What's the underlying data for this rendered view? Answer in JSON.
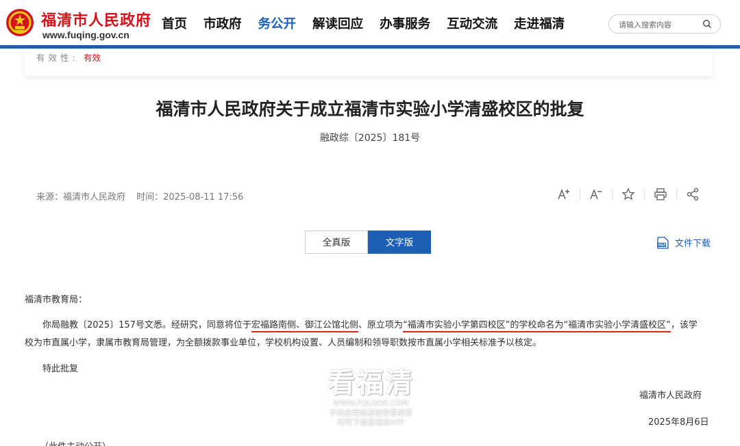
{
  "header": {
    "site_title": "福清市人民政府",
    "site_url": "www.fuqing.gov.cn",
    "nav": [
      "首页",
      "市政府",
      "务公开",
      "解读回应",
      "办事服务",
      "互动交流",
      "走进福清"
    ],
    "nav_active_index": 2,
    "search_placeholder": "请输入搜索内容"
  },
  "info": {
    "label": "有效性:",
    "value": "有效"
  },
  "document": {
    "title": "福清市人民政府关于成立福清市实验小学清盛校区的批复",
    "number": "融政综〔2025〕181号",
    "source": "来源：福清市人民政府",
    "time": "时间：2025-08-11 17:56"
  },
  "tabs": {
    "full": "全真版",
    "text": "文字版",
    "active": "text"
  },
  "download_label": "文件下载",
  "body": {
    "salutation": "福清市教育局：",
    "p1_a": "你局融教〔2025〕157号文悉。经研究，同意将位于",
    "p1_u1": "宏福路南侧、御江公馆北侧",
    "p1_b": "、原立项为",
    "p1_u2": "“福清市实验小学第四校区”的学校命名为“福清市实验小学清盛校区”",
    "p1_c": "，该学",
    "p2": "校为市直属小学，隶属市教育局管理，为全额拨款事业单位，学校机构设置、人员编制和领导职数按市直属小学相关标准予以核定。",
    "p3": "特此批复",
    "signer": "福清市人民政府",
    "date": "2025年8月6日",
    "footnote": "（此件主动公开）"
  },
  "watermark": {
    "big": "看福清",
    "url": "WWW.FQLOOK.COM",
    "line1": "手机应用商店搜索看福清",
    "line2": "均可下载看福清APP"
  },
  "colors": {
    "brand_blue": "#1d5fb4",
    "brand_red": "#d4121a"
  }
}
